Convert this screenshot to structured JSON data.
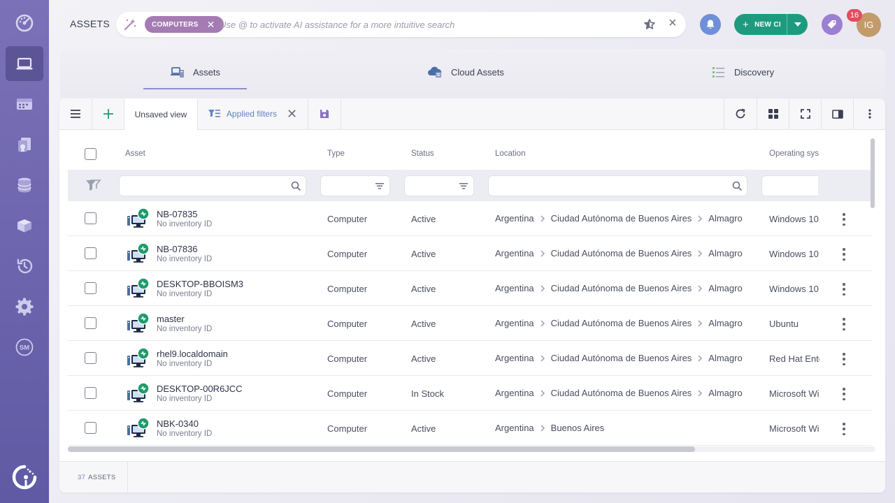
{
  "sidebar": {
    "items": [
      {
        "icon": "dashboard-icon"
      },
      {
        "icon": "laptop-icon",
        "active": true
      },
      {
        "icon": "service-catalog-icon"
      },
      {
        "icon": "contracts-icon"
      },
      {
        "icon": "database-icon"
      },
      {
        "icon": "packages-icon"
      },
      {
        "icon": "history-icon"
      },
      {
        "icon": "settings-icon"
      },
      {
        "icon": "sm-icon",
        "label": "SM"
      }
    ],
    "logo_icon": "logo-icon"
  },
  "topbar": {
    "title": "ASSETS",
    "search_chip": "COMPUTERS",
    "search_placeholder": "Use @ to activate AI assistance for a more intuitive search",
    "new_ci_label": "NEW CI",
    "notification_count": "16",
    "avatar_initials": "IG"
  },
  "tabs": [
    {
      "label": "Assets",
      "active": true
    },
    {
      "label": "Cloud Assets"
    },
    {
      "label": "Discovery"
    }
  ],
  "toolbar": {
    "view_label": "Unsaved view",
    "filters_label": "Applied filters"
  },
  "table": {
    "columns": [
      "Asset",
      "Type",
      "Status",
      "Location",
      "Operating sys"
    ],
    "rows": [
      {
        "name": "NB-07835",
        "inventory": "No inventory ID",
        "type": "Computer",
        "status": "Active",
        "location": [
          "Argentina",
          "Ciudad Autónoma de Buenos Aires",
          "Almagro"
        ],
        "os": "Windows 10"
      },
      {
        "name": "NB-07836",
        "inventory": "No inventory ID",
        "type": "Computer",
        "status": "Active",
        "location": [
          "Argentina",
          "Ciudad Autónoma de Buenos Aires",
          "Almagro"
        ],
        "os": "Windows 10"
      },
      {
        "name": "DESKTOP-BBOISM3",
        "inventory": "No inventory ID",
        "type": "Computer",
        "status": "Active",
        "location": [
          "Argentina",
          "Ciudad Autónoma de Buenos Aires",
          "Almagro"
        ],
        "os": "Windows 10"
      },
      {
        "name": "master",
        "inventory": "No inventory ID",
        "type": "Computer",
        "status": "Active",
        "location": [
          "Argentina",
          "Ciudad Autónoma de Buenos Aires",
          "Almagro"
        ],
        "os": "Ubuntu"
      },
      {
        "name": "rhel9.localdomain",
        "inventory": "No inventory ID",
        "type": "Computer",
        "status": "Active",
        "location": [
          "Argentina",
          "Ciudad Autónoma de Buenos Aires",
          "Almagro"
        ],
        "os": "Red Hat Ente"
      },
      {
        "name": "DESKTOP-00R6JCC",
        "inventory": "No inventory ID",
        "type": "Computer",
        "status": "In Stock",
        "location": [
          "Argentina",
          "Ciudad Autónoma de Buenos Aires",
          "Almagro"
        ],
        "os": "Microsoft Wi"
      },
      {
        "name": "NBK-0340",
        "inventory": "No inventory ID",
        "type": "Computer",
        "status": "Active",
        "location": [
          "Argentina",
          "Buenos Aires"
        ],
        "os": "Microsoft Wi"
      }
    ]
  },
  "footer": {
    "count": "37",
    "count_label": "ASSETS"
  },
  "colors": {
    "sidebar": "#6c64ad",
    "chip": "#a57bb4",
    "new_ci": "#1e9b7f",
    "bell": "#6f8fd8",
    "tag": "#9b7fd0",
    "badge": "#e34d5f",
    "asset_ok": "#1f9b6b"
  }
}
